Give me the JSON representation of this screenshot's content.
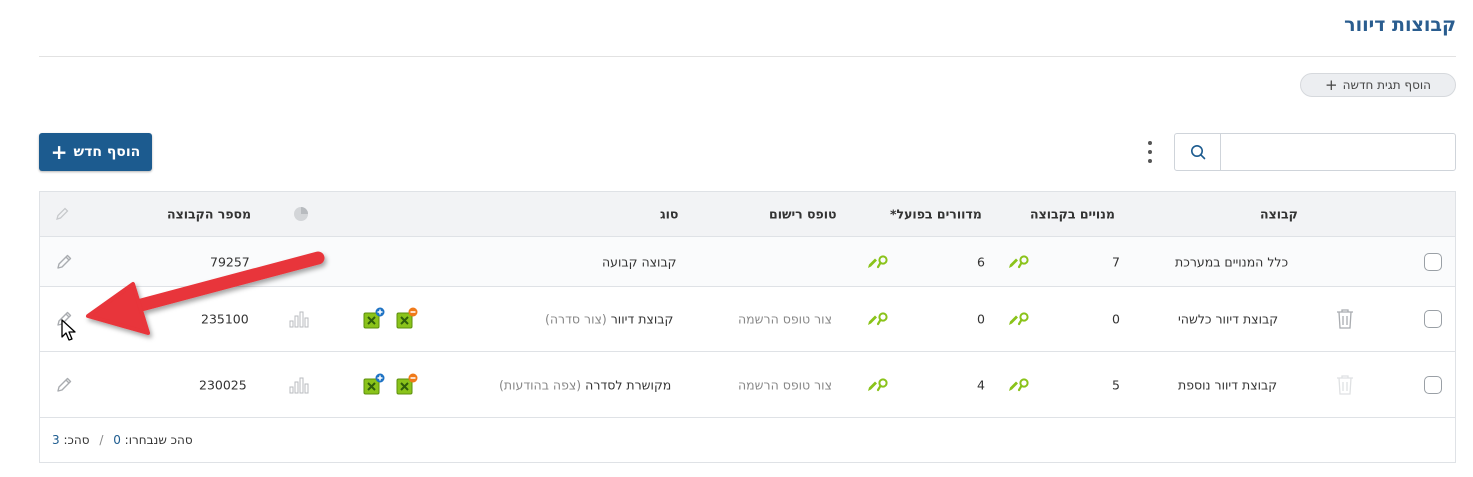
{
  "page": {
    "title": "קבוצות דיוור"
  },
  "toolbar": {
    "add_tag_label": "הוסף תגית חדשה",
    "add_new_label": "הוסף חדש",
    "search_value": "",
    "search_placeholder": ""
  },
  "table": {
    "headers": {
      "group": "קבוצה",
      "members": "מנויים בקבוצה",
      "mailed": "מדוורים בפועל*",
      "reg_form": "טופס רישום",
      "type": "סוג",
      "group_number": "מספר הקבוצה"
    },
    "rows": [
      {
        "group": "כלל המנויים במערכת",
        "members": "7",
        "mailed": "6",
        "reg_form": "",
        "type": "קבוצה קבועה",
        "type_note": "",
        "group_number": "79257"
      },
      {
        "group": "קבוצת דיוור כלשהי",
        "members": "0",
        "mailed": "0",
        "reg_form": "צור טופס הרשמה",
        "type": "קבוצת דיוור",
        "type_note": "(צור סדרה)",
        "group_number": "235100"
      },
      {
        "group": "קבוצת דיוור נוספת",
        "members": "5",
        "mailed": "4",
        "reg_form": "צור טופס הרשמה",
        "type": "מקושרת לסדרה",
        "type_note": "(צפה בהודעות)",
        "group_number": "230025"
      }
    ],
    "footer": {
      "selected_label": "סהכ שנבחרו:",
      "selected_count": "0",
      "separator": "/",
      "total_label": "סהכ:",
      "total_count": "3"
    }
  },
  "colors": {
    "primary": "#1c5b8f",
    "title": "#2a5d8f",
    "accent_green": "#8ac31a",
    "annotation_arrow": "#e8343a"
  }
}
